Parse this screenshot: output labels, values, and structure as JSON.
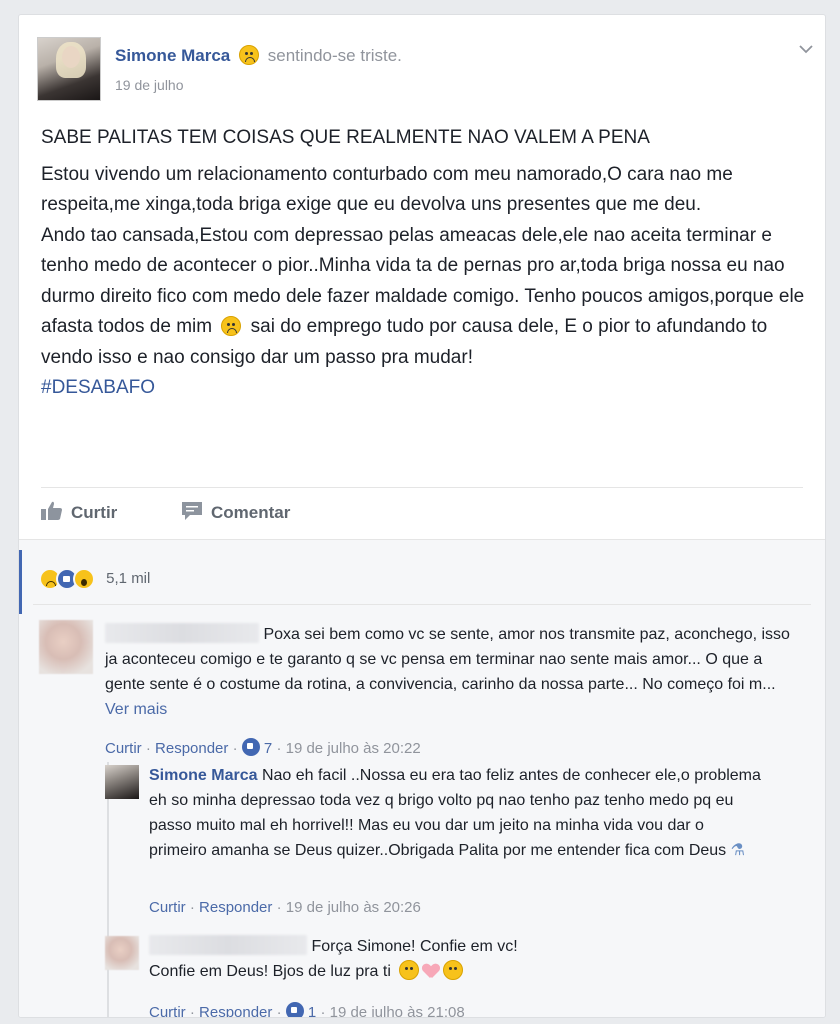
{
  "post": {
    "author": "Simone Marca",
    "feeling": "sentindo-se triste.",
    "date": "19 de julho",
    "title": "SABE PALITAS TEM COISAS QUE REALMENTE NAO VALEM A PENA",
    "paragraph1": "Estou vivendo um relacionamento conturbado com meu namorado,O cara nao me respeita,me xinga,toda briga exige que eu devolva uns presentes que me deu.",
    "paragraph2": "Ando tao cansada,Estou com depressao pelas ameacas dele,ele nao aceita terminar e tenho medo de acontecer o pior..Minha vida ta de pernas pro ar,toda briga nossa eu nao durmo direito fico com medo dele fazer maldade comigo. Tenho poucos amigos,porque ele afasta todos de mim",
    "paragraph2b": "sai do emprego tudo por causa dele, E o pior to afundando to vendo isso e nao consigo dar um passo pra mudar!",
    "hashtag": "#DESABAFO"
  },
  "actions": {
    "like": "Curtir",
    "comment": "Comentar"
  },
  "reactions": {
    "count": "5,1 mil",
    "icons": [
      "sad-reaction",
      "like-reaction",
      "wow-reaction"
    ]
  },
  "comments": [
    {
      "text": "Poxa sei bem como vc se sente, amor nos transmite paz, aconchego, isso ja aconteceu comigo e te garanto q se vc pensa em terminar nao sente mais amor... O que a gente sente é o costume da rotina, a convivencia, carinho da nossa parte... No começo foi m...",
      "more": "Ver mais",
      "like": "Curtir",
      "reply": "Responder",
      "likes": "7",
      "time": "19 de julho às 20:22"
    }
  ],
  "replies": [
    {
      "author": "Simone Marca",
      "text": "Nao eh facil ..Nossa eu era tao feliz antes de conhecer ele,o problema eh so minha depressao toda vez q brigo volto pq nao tenho paz tenho medo pq eu passo muito mal eh horrivel!! Mas eu vou dar um jeito na minha vida vou dar o primeiro amanha se Deus quizer..Obrigada Palita por me entender fica com Deus",
      "like": "Curtir",
      "reply": "Responder",
      "time": "19 de julho às 20:26"
    },
    {
      "text": "Força Simone! Confie em vc! Confie em Deus! Bjos de luz pra ti",
      "like": "Curtir",
      "reply": "Responder",
      "likes": "1",
      "time": "19 de julho às 21:08"
    }
  ],
  "separator": "·",
  "colors": {
    "link": "#365899",
    "accent": "#4267b2",
    "muted": "#90949c",
    "background": "#e9ebee"
  }
}
